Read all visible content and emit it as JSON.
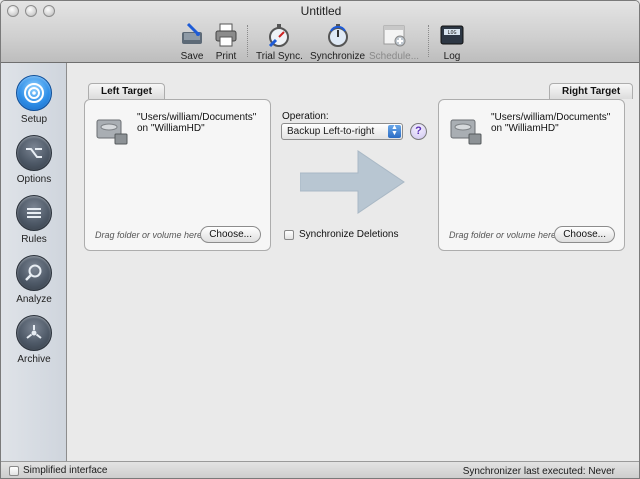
{
  "window": {
    "title": "Untitled"
  },
  "toolbar": {
    "save": "Save",
    "print": "Print",
    "trial_sync": "Trial Sync.",
    "synchronize": "Synchronize",
    "schedule": "Schedule...",
    "log": "Log"
  },
  "sidebar": {
    "items": [
      {
        "label": "Setup",
        "icon": "setup-icon",
        "active": true
      },
      {
        "label": "Options",
        "icon": "options-icon",
        "active": false
      },
      {
        "label": "Rules",
        "icon": "rules-icon",
        "active": false
      },
      {
        "label": "Analyze",
        "icon": "analyze-icon",
        "active": false
      },
      {
        "label": "Archive",
        "icon": "archive-icon",
        "active": false
      }
    ]
  },
  "left_target": {
    "title": "Left Target",
    "path_line1": "\"Users/william/Documents\"",
    "path_line2": "on \"WilliamHD\"",
    "hint": "Drag folder or volume here...",
    "choose": "Choose..."
  },
  "right_target": {
    "title": "Right Target",
    "path_line1": "\"Users/william/Documents\"",
    "path_line2": "on \"WilliamHD\"",
    "hint": "Drag folder or volume here...",
    "choose": "Choose..."
  },
  "operation": {
    "label": "Operation:",
    "selected": "Backup Left-to-right",
    "help": "?"
  },
  "sync_deletions": {
    "label": "Synchronize Deletions",
    "checked": false
  },
  "status": {
    "simplified": "Simplified interface",
    "last_executed": "Synchronizer last executed:  Never"
  },
  "colors": {
    "accent": "#2f8fe8",
    "arrow": "#b8c6d2"
  }
}
